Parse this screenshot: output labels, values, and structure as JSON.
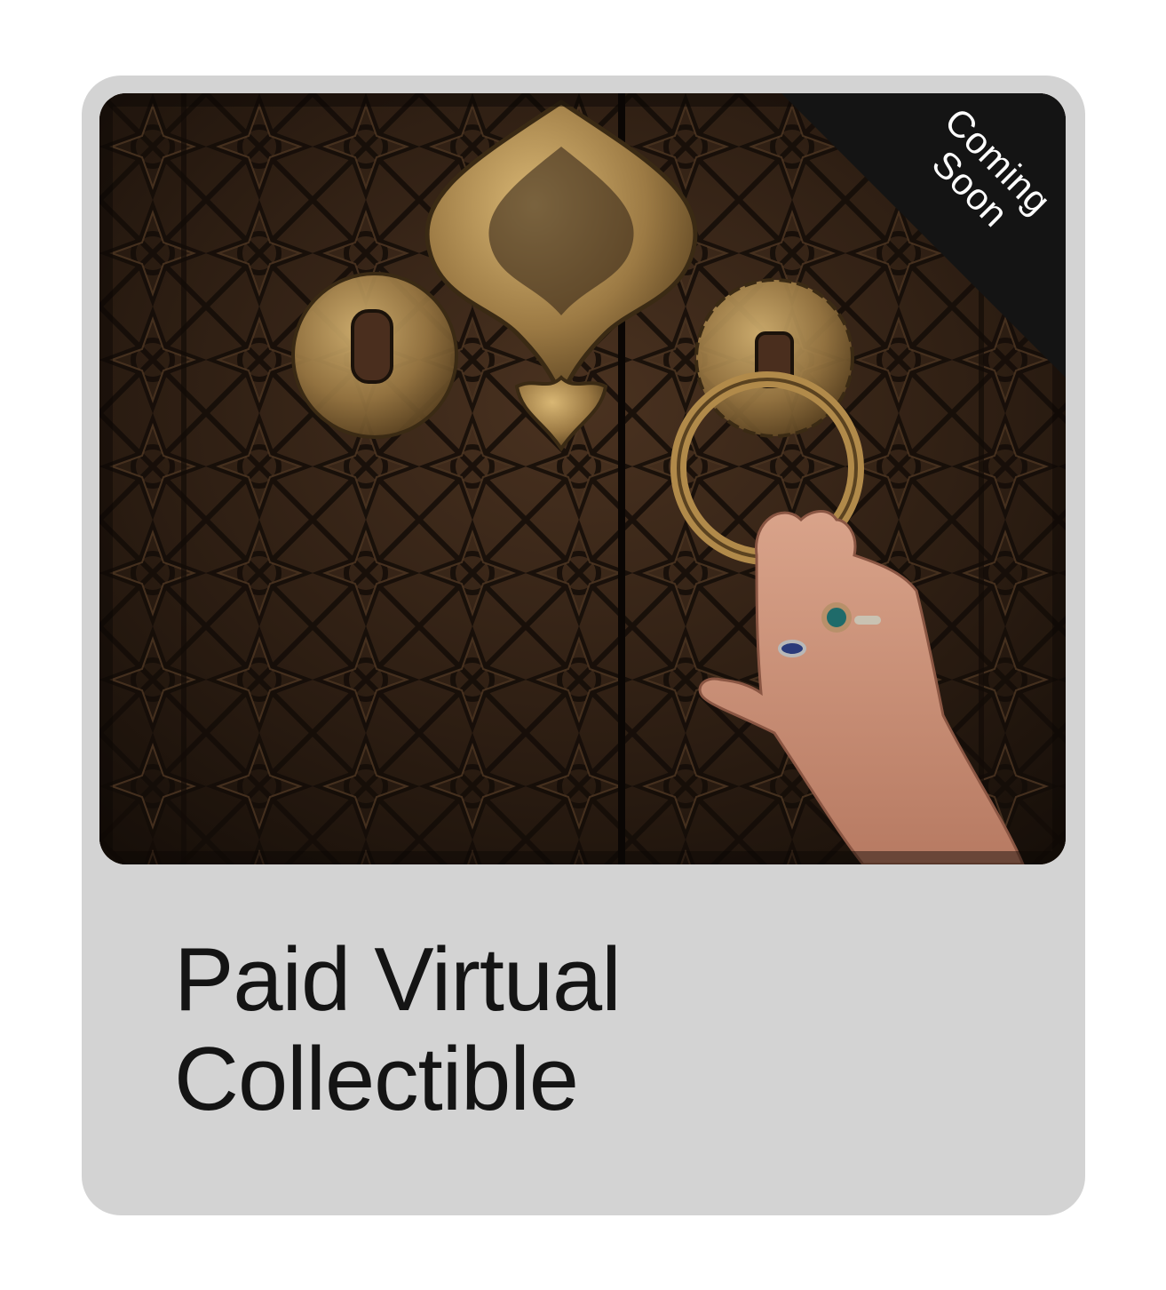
{
  "card": {
    "badge": {
      "line1": "Coming",
      "line2": "Soon"
    },
    "title": {
      "line1": "Paid Virtual",
      "line2": "Collectible"
    },
    "image": {
      "subject": "carved-wooden-door-with-brass-knocker-and-hand"
    }
  },
  "colors": {
    "card_bg": "#d3d3d3",
    "badge_bg": "#141414",
    "badge_text": "#ffffff",
    "title_text": "#141414"
  }
}
